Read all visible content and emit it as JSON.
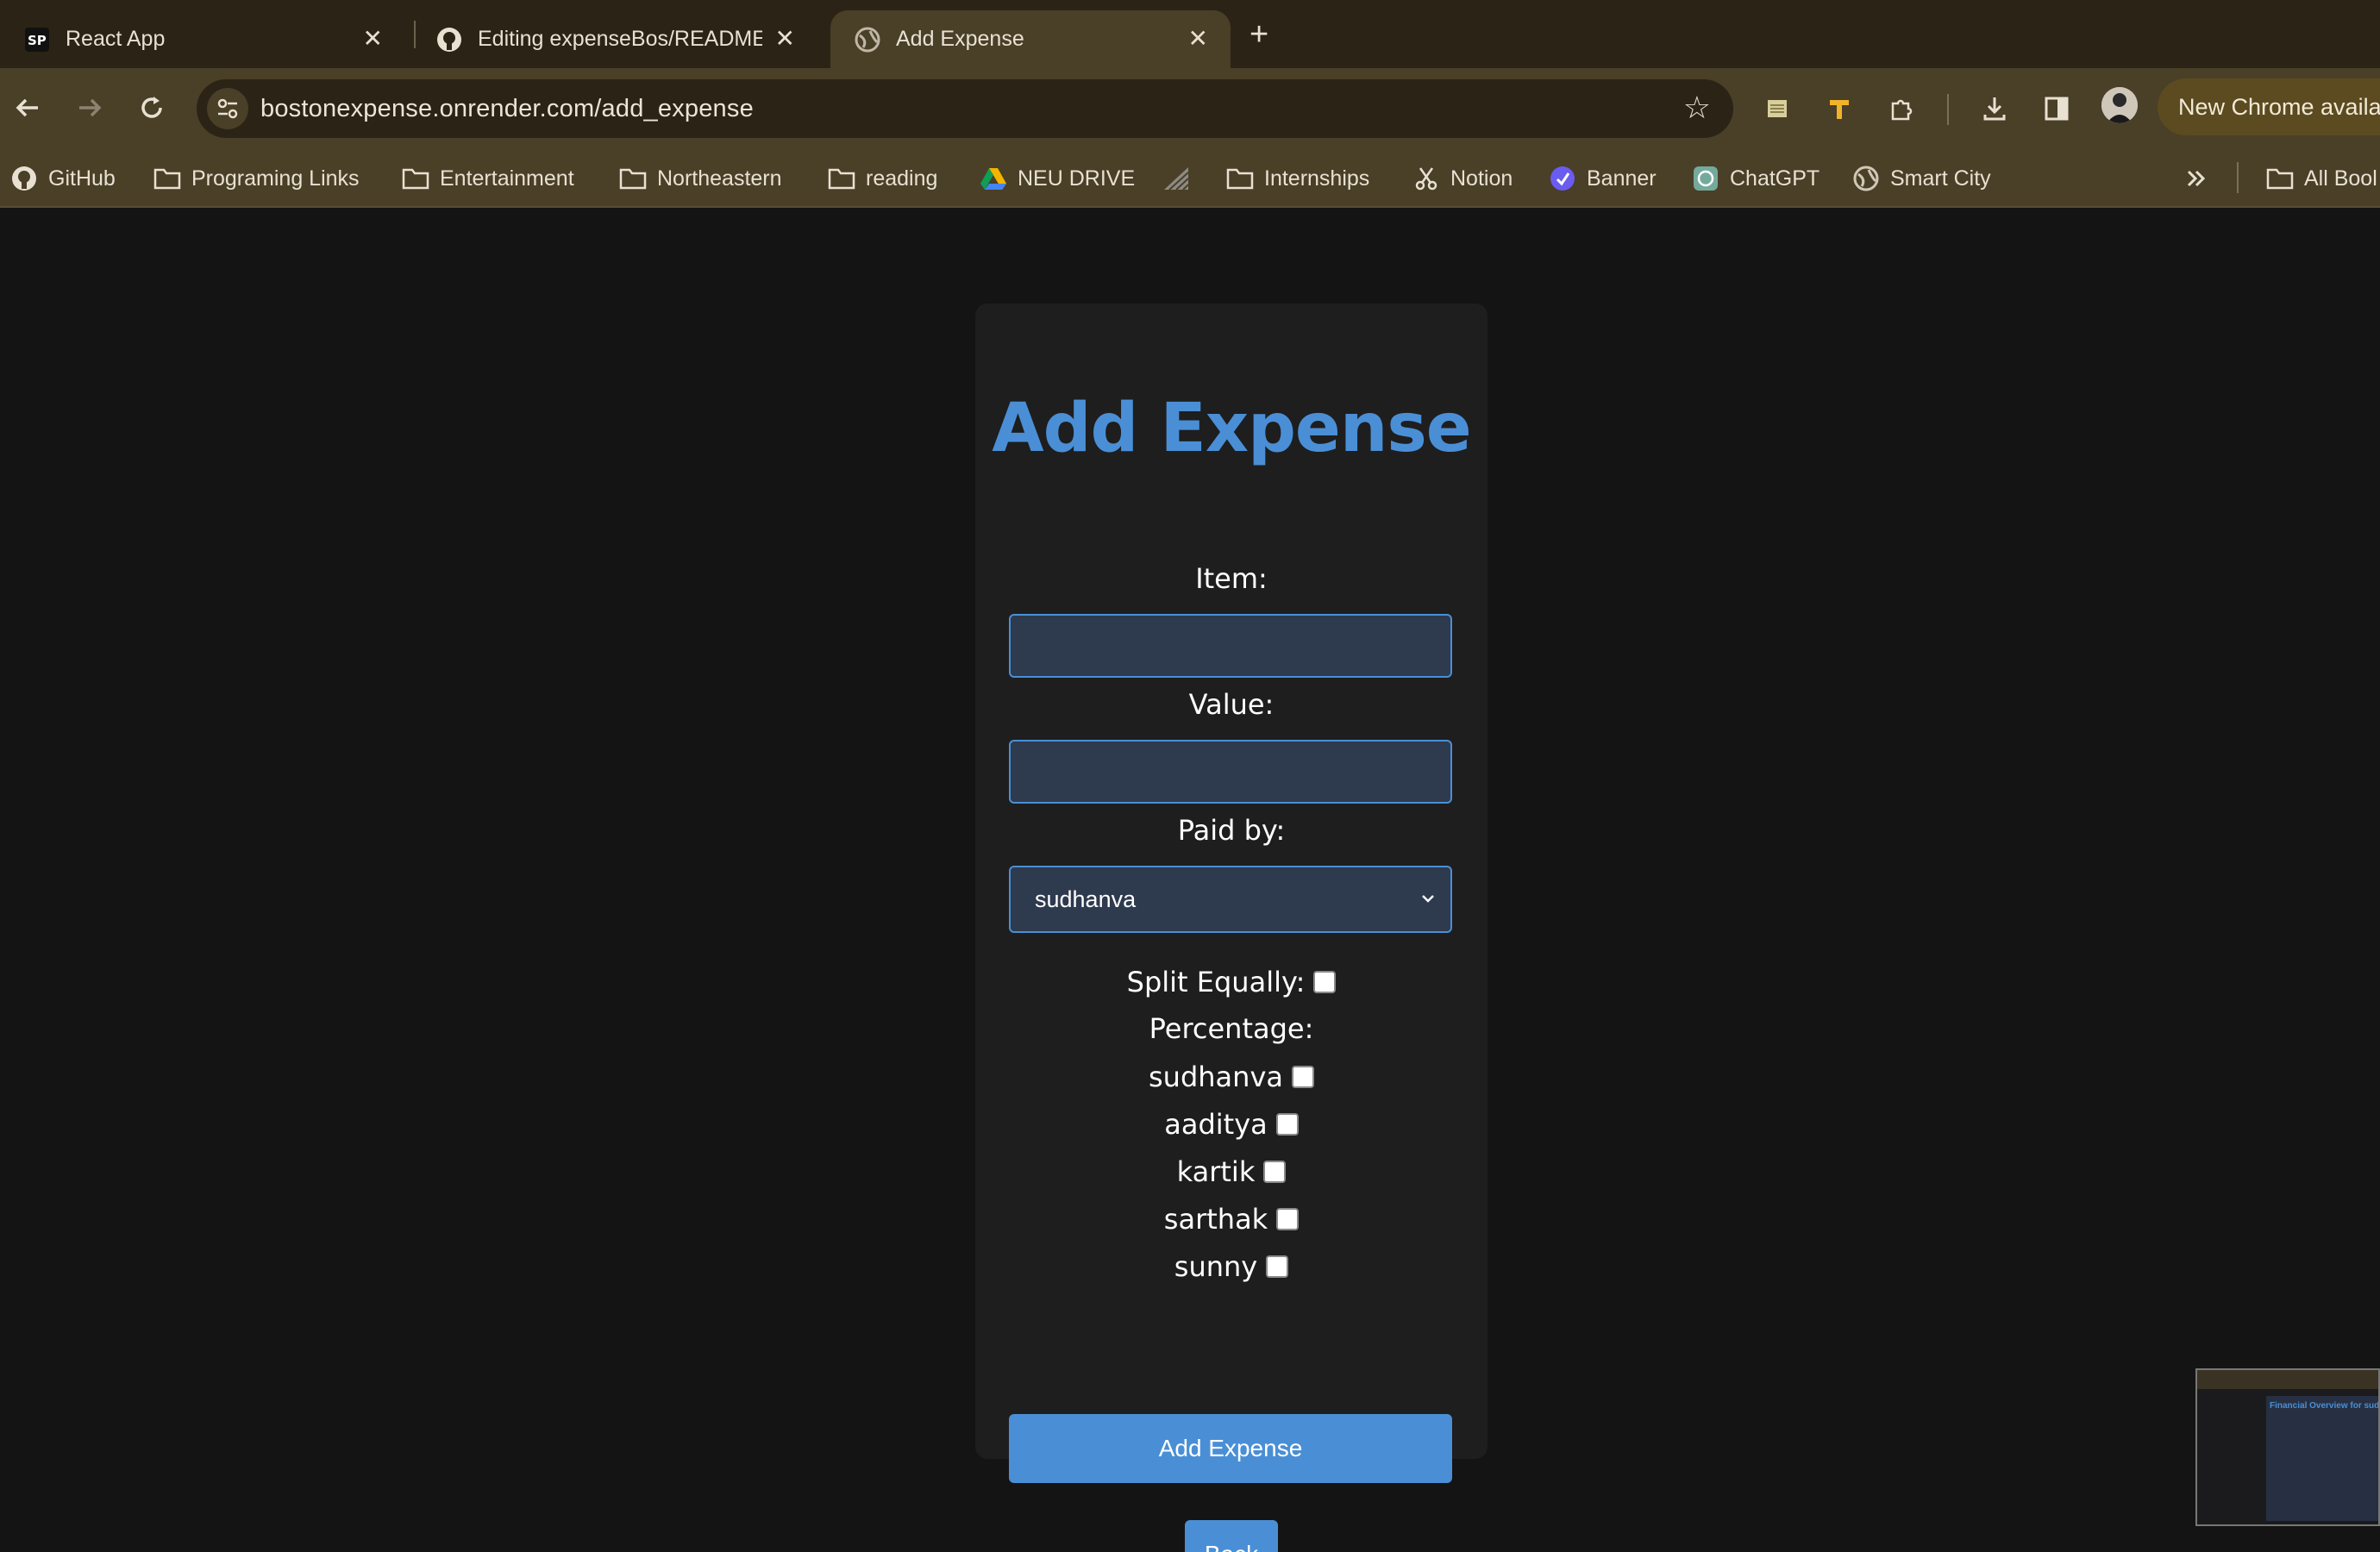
{
  "tabs": [
    {
      "title": "React App",
      "active": false
    },
    {
      "title": "Editing expenseBos/README",
      "active": false
    },
    {
      "title": "Add Expense",
      "active": true
    }
  ],
  "toolbar": {
    "url": "bostonexpense.onrender.com/add_expense",
    "update_label": "New Chrome availa"
  },
  "bookmarks": [
    {
      "label": "GitHub",
      "icon": "github-icon"
    },
    {
      "label": "Programing Links",
      "icon": "folder-icon"
    },
    {
      "label": "Entertainment",
      "icon": "folder-icon"
    },
    {
      "label": "Northeastern",
      "icon": "folder-icon"
    },
    {
      "label": "reading",
      "icon": "folder-icon"
    },
    {
      "label": "NEU DRIVE",
      "icon": "drive-icon"
    },
    {
      "label": "",
      "icon": "stripes-icon"
    },
    {
      "label": "Internships",
      "icon": "folder-icon"
    },
    {
      "label": "Notion",
      "icon": "scissors-icon"
    },
    {
      "label": "Banner",
      "icon": "banner-icon"
    },
    {
      "label": "ChatGPT",
      "icon": "chatgpt-icon"
    },
    {
      "label": "Smart City",
      "icon": "globe-icon"
    },
    {
      "label": "All Bool",
      "icon": "folder-icon"
    }
  ],
  "form": {
    "title": "Add Expense",
    "item_label": "Item:",
    "item_value": "",
    "value_label": "Value:",
    "value_value": "",
    "paid_by_label": "Paid by:",
    "paid_by_selected": "sudhanva",
    "split_equally_label": "Split Equally:",
    "split_equally_checked": false,
    "percentage_label": "Percentage:",
    "people": [
      {
        "name": "sudhanva",
        "checked": false
      },
      {
        "name": "aaditya",
        "checked": false
      },
      {
        "name": "kartik",
        "checked": false
      },
      {
        "name": "sarthak",
        "checked": false
      },
      {
        "name": "sunny",
        "checked": false
      }
    ],
    "submit_label": "Add Expense",
    "back_label": "Back"
  },
  "thumbnail": {
    "title": "Financial Overview for sudhanva"
  },
  "colors": {
    "accent": "#4a8fd6",
    "card_bg": "#1e1e1f",
    "page_bg": "#141414",
    "chrome_bg": "#4a3f27"
  }
}
